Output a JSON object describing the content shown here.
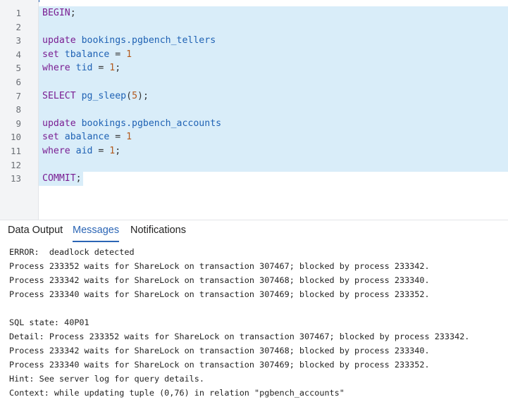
{
  "editor": {
    "line_numbers": [
      "1",
      "2",
      "3",
      "4",
      "5",
      "6",
      "7",
      "8",
      "9",
      "10",
      "11",
      "12",
      "13"
    ],
    "lines": [
      [
        {
          "t": "BEGIN",
          "c": "kw"
        },
        {
          "t": ";",
          "c": "pun"
        }
      ],
      [],
      [
        {
          "t": "update",
          "c": "kw"
        },
        {
          "t": " bookings.pgbench_tellers",
          "c": "fn"
        }
      ],
      [
        {
          "t": "set",
          "c": "kw"
        },
        {
          "t": " tbalance ",
          "c": "fn"
        },
        {
          "t": "= ",
          "c": "pun"
        },
        {
          "t": "1",
          "c": "num"
        }
      ],
      [
        {
          "t": "where",
          "c": "kw"
        },
        {
          "t": " tid ",
          "c": "fn"
        },
        {
          "t": "= ",
          "c": "pun"
        },
        {
          "t": "1",
          "c": "num"
        },
        {
          "t": ";",
          "c": "pun"
        }
      ],
      [],
      [
        {
          "t": "SELECT",
          "c": "kw"
        },
        {
          "t": " pg_sleep",
          "c": "fn"
        },
        {
          "t": "(",
          "c": "pun"
        },
        {
          "t": "5",
          "c": "num"
        },
        {
          "t": ");",
          "c": "pun"
        }
      ],
      [],
      [
        {
          "t": "update",
          "c": "kw"
        },
        {
          "t": " bookings.pgbench_accounts",
          "c": "fn"
        }
      ],
      [
        {
          "t": "set",
          "c": "kw"
        },
        {
          "t": " abalance ",
          "c": "fn"
        },
        {
          "t": "= ",
          "c": "pun"
        },
        {
          "t": "1",
          "c": "num"
        }
      ],
      [
        {
          "t": "where",
          "c": "kw"
        },
        {
          "t": " aid ",
          "c": "fn"
        },
        {
          "t": "= ",
          "c": "pun"
        },
        {
          "t": "1",
          "c": "num"
        },
        {
          "t": ";",
          "c": "pun"
        }
      ],
      [],
      [
        {
          "t": "COMMIT",
          "c": "kw"
        },
        {
          "t": ";",
          "c": "pun"
        }
      ]
    ]
  },
  "tabs": {
    "data_output": "Data Output",
    "messages": "Messages",
    "notifications": "Notifications",
    "active": "messages"
  },
  "messages": {
    "lines": [
      "ERROR:  deadlock detected",
      "Process 233352 waits for ShareLock on transaction 307467; blocked by process 233342.",
      "Process 233342 waits for ShareLock on transaction 307468; blocked by process 233340.",
      "Process 233340 waits for ShareLock on transaction 307469; blocked by process 233352.",
      "",
      "SQL state: 40P01",
      "Detail: Process 233352 waits for ShareLock on transaction 307467; blocked by process 233342.",
      "Process 233342 waits for ShareLock on transaction 307468; blocked by process 233340.",
      "Process 233340 waits for ShareLock on transaction 307469; blocked by process 233352.",
      "Hint: See server log for query details.",
      "Context: while updating tuple (0,76) in relation \"pgbench_accounts\""
    ]
  },
  "colors": {
    "accent": "#2b65b5",
    "selection": "#d9edf9",
    "keyword": "#7a1e92",
    "identifier": "#1f62b4",
    "number": "#b35a1d"
  }
}
